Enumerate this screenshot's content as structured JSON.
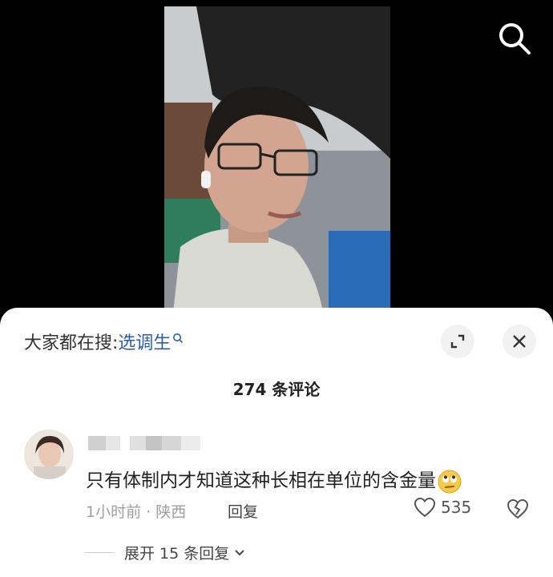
{
  "header": {
    "search_icon": "search-icon"
  },
  "sheet": {
    "trending_label": "大家都在搜:",
    "trending_term": "选调生",
    "expand_icon": "expand-icon",
    "close_icon": "close-icon",
    "comment_count": "274 条评论"
  },
  "comment": {
    "text": "只有体制内才知道这种长相在单位的含金量",
    "emoji": "eye-roll-emoji",
    "time_location": "1小时前 · 陕西",
    "reply_label": "回复",
    "like_count": "535",
    "expand_replies": "展开 15 条回复"
  },
  "colors": {
    "link": "#2d5fa8",
    "muted": "#a0a0a0"
  }
}
